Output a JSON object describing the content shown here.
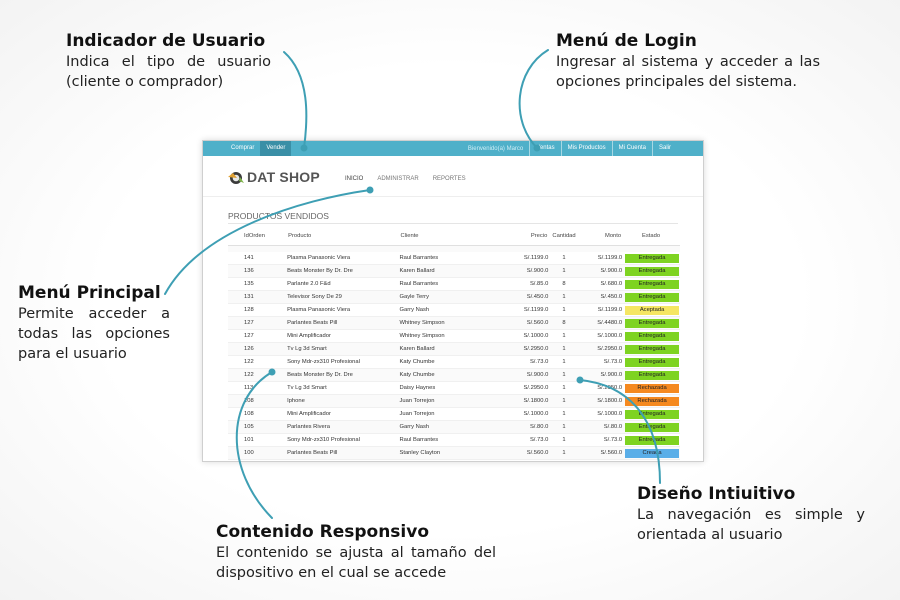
{
  "callouts": {
    "user_indicator": {
      "title": "Indicador de Usuario",
      "desc": "Indica el tipo de usuario (cliente o comprador)"
    },
    "login_menu": {
      "title": "Menú de Login",
      "desc": "Ingresar al sistema y acceder a las opciones principales del sistema."
    },
    "main_menu": {
      "title": "Menú Principal",
      "desc": "Permite acceder a todas las opciones para el usuario"
    },
    "responsive_content": {
      "title": "Contenido Responsivo",
      "desc": "El contenido se ajusta al tamaño del dispositivo en el cual se accede"
    },
    "intuitive_design": {
      "title": "Diseño Intiuitivo",
      "desc": "La navegación es simple y orientada al usuario"
    }
  },
  "app": {
    "topbar": {
      "left_items": [
        "Comprar",
        "Vender"
      ],
      "active_left": "Vender",
      "greeting": "Bienvenido(a) Marco",
      "right_links": [
        "Ventas",
        "Mis Productos",
        "Mi Cuenta",
        "Salir"
      ]
    },
    "brand": "DAT SHOP",
    "nav": [
      "INICIO",
      "ADMINISTRAR",
      "REPORTES"
    ],
    "section_title": "PRODUCTOS VENDIDOS",
    "table": {
      "headers": [
        "IdOrden",
        "Producto",
        "Cliente",
        "Precio",
        "Cantidad",
        "Monto",
        "Estado"
      ],
      "rows": [
        [
          "141",
          "Plasma Panasonic Viera",
          "Raul Barrantes",
          "S/.1199.0",
          "1",
          "S/.1199.0",
          "Entregada"
        ],
        [
          "136",
          "Beats Monster By Dr. Dre",
          "Karen Ballard",
          "S/.900.0",
          "1",
          "S/.900.0",
          "Entregada"
        ],
        [
          "135",
          "Parlante 2.0 F&d",
          "Raul Barrantes",
          "S/.85.0",
          "8",
          "S/.680.0",
          "Entregada"
        ],
        [
          "131",
          "Televisor Sony De 29",
          "Gayle Terry",
          "S/.450.0",
          "1",
          "S/.450.0",
          "Entregada"
        ],
        [
          "128",
          "Plasma Panasonic Viera",
          "Garry Nash",
          "S/.1199.0",
          "1",
          "S/.1199.0",
          "Aceptada"
        ],
        [
          "127",
          "Parlantes Beats Pill",
          "Whitney Simpson",
          "S/.560.0",
          "8",
          "S/.4480.0",
          "Entregada"
        ],
        [
          "127",
          "Mini Amplificador",
          "Whitney Simpson",
          "S/.1000.0",
          "1",
          "S/.1000.0",
          "Entregada"
        ],
        [
          "126",
          "Tv Lg 3d Smart",
          "Karen Ballard",
          "S/.2950.0",
          "1",
          "S/.2950.0",
          "Entregada"
        ],
        [
          "122",
          "Sony Mdr-zx310 Profesional",
          "Katy Chumbe",
          "S/.73.0",
          "1",
          "S/.73.0",
          "Entregada"
        ],
        [
          "122",
          "Beats Monster By Dr. Dre",
          "Katy Chumbe",
          "S/.900.0",
          "1",
          "S/.900.0",
          "Entregada"
        ],
        [
          "113",
          "Tv Lg 3d Smart",
          "Daisy Haynes",
          "S/.2950.0",
          "1",
          "S/.2950.0",
          "Rechazada"
        ],
        [
          "108",
          "Iphone",
          "Juan Torrejon",
          "S/.1800.0",
          "1",
          "S/.1800.0",
          "Rechazada"
        ],
        [
          "108",
          "Mini Amplificador",
          "Juan Torrejon",
          "S/.1000.0",
          "1",
          "S/.1000.0",
          "Entregada"
        ],
        [
          "105",
          "Parlantes Rivera",
          "Garry Nash",
          "S/.80.0",
          "1",
          "S/.80.0",
          "Entregada"
        ],
        [
          "101",
          "Sony Mdr-zx310 Profesional",
          "Raul Barrantes",
          "S/.73.0",
          "1",
          "S/.73.0",
          "Entregada"
        ],
        [
          "100",
          "Parlantes Beats Pill",
          "Stanley Clayton",
          "S/.560.0",
          "1",
          "S/.560.0",
          "Creada"
        ]
      ]
    },
    "status_colors": {
      "Entregada": "#7ed321",
      "Aceptada": "#f5e663",
      "Rechazada": "#f5891f",
      "Creada": "#5aaee8"
    },
    "accent": "#4fb0c9",
    "connector_color": "#3e9fb4"
  }
}
